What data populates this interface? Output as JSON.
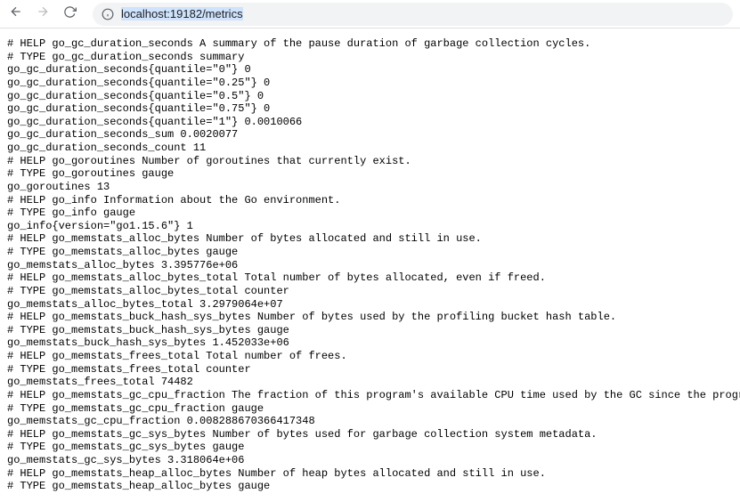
{
  "browser": {
    "url_prefix": "",
    "url_selected": "localhost:19182/metrics",
    "back_icon": "back-icon",
    "forward_icon": "forward-icon",
    "reload_icon": "reload-icon",
    "info_icon": "info-icon"
  },
  "metrics_text": "# HELP go_gc_duration_seconds A summary of the pause duration of garbage collection cycles.\n# TYPE go_gc_duration_seconds summary\ngo_gc_duration_seconds{quantile=\"0\"} 0\ngo_gc_duration_seconds{quantile=\"0.25\"} 0\ngo_gc_duration_seconds{quantile=\"0.5\"} 0\ngo_gc_duration_seconds{quantile=\"0.75\"} 0\ngo_gc_duration_seconds{quantile=\"1\"} 0.0010066\ngo_gc_duration_seconds_sum 0.0020077\ngo_gc_duration_seconds_count 11\n# HELP go_goroutines Number of goroutines that currently exist.\n# TYPE go_goroutines gauge\ngo_goroutines 13\n# HELP go_info Information about the Go environment.\n# TYPE go_info gauge\ngo_info{version=\"go1.15.6\"} 1\n# HELP go_memstats_alloc_bytes Number of bytes allocated and still in use.\n# TYPE go_memstats_alloc_bytes gauge\ngo_memstats_alloc_bytes 3.395776e+06\n# HELP go_memstats_alloc_bytes_total Total number of bytes allocated, even if freed.\n# TYPE go_memstats_alloc_bytes_total counter\ngo_memstats_alloc_bytes_total 3.2979064e+07\n# HELP go_memstats_buck_hash_sys_bytes Number of bytes used by the profiling bucket hash table.\n# TYPE go_memstats_buck_hash_sys_bytes gauge\ngo_memstats_buck_hash_sys_bytes 1.452033e+06\n# HELP go_memstats_frees_total Total number of frees.\n# TYPE go_memstats_frees_total counter\ngo_memstats_frees_total 74482\n# HELP go_memstats_gc_cpu_fraction The fraction of this program's available CPU time used by the GC since the program started.\n# TYPE go_memstats_gc_cpu_fraction gauge\ngo_memstats_gc_cpu_fraction 0.008288670366417348\n# HELP go_memstats_gc_sys_bytes Number of bytes used for garbage collection system metadata.\n# TYPE go_memstats_gc_sys_bytes gauge\ngo_memstats_gc_sys_bytes 3.318064e+06\n# HELP go_memstats_heap_alloc_bytes Number of heap bytes allocated and still in use.\n# TYPE go_memstats_heap_alloc_bytes gauge"
}
